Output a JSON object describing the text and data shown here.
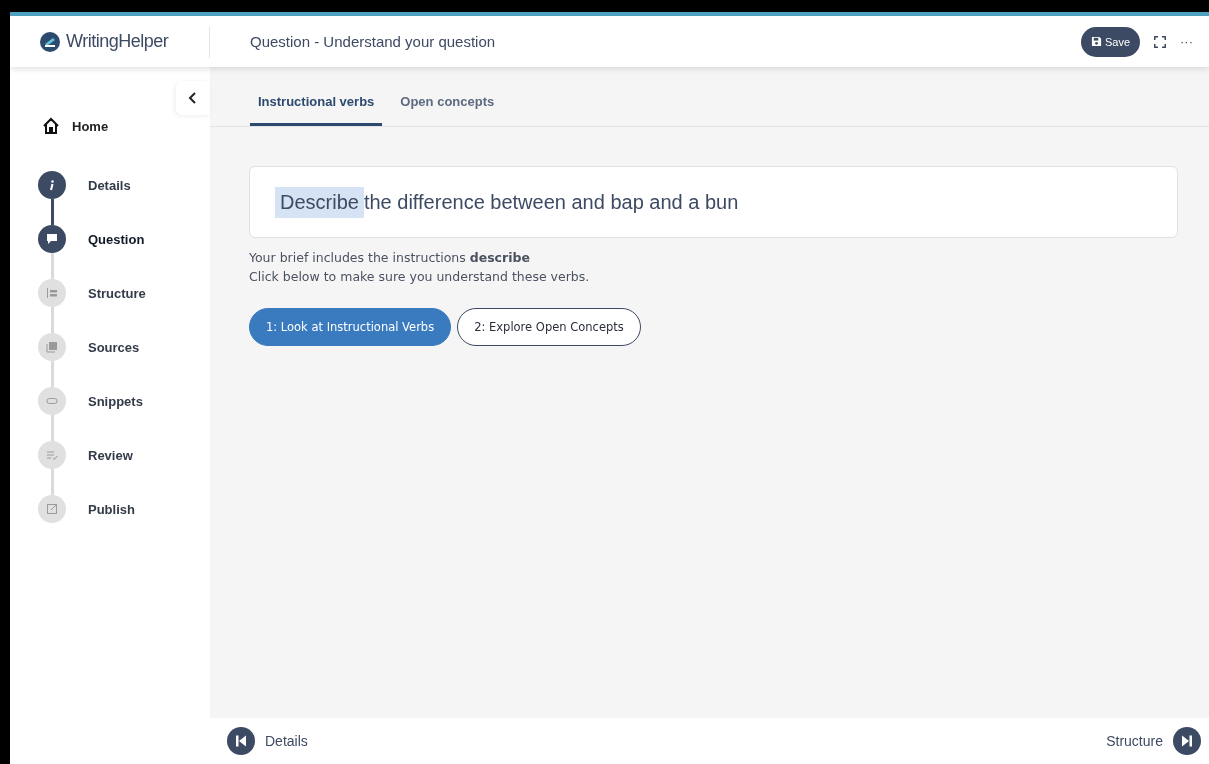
{
  "app": {
    "brand": "WritingHelper",
    "title": "Question - Understand your question",
    "save": "Save",
    "more": "···"
  },
  "sidebar": {
    "home": "Home",
    "steps": [
      {
        "label": "Details",
        "done": true,
        "selected": false
      },
      {
        "label": "Question",
        "done": false,
        "selected": true
      },
      {
        "label": "Structure",
        "done": false,
        "selected": false
      },
      {
        "label": "Sources",
        "done": false,
        "selected": false
      },
      {
        "label": "Snippets",
        "done": false,
        "selected": false
      },
      {
        "label": "Review",
        "done": false,
        "selected": false
      },
      {
        "label": "Publish",
        "done": false,
        "selected": false
      }
    ]
  },
  "tabs": [
    {
      "label": "Instructional verbs",
      "selected": true
    },
    {
      "label": "Open concepts",
      "selected": false
    }
  ],
  "question": {
    "highlighted": "Describe",
    "text": "the difference between and bap and a bun"
  },
  "brief": [
    "Your brief includes the instructions **describe**",
    "Click below to make sure you understand these verbs."
  ],
  "actions": [
    {
      "label": "1: Look at Instructional Verbs",
      "selected": true
    },
    {
      "label": "2: Explore Open Concepts",
      "selected": false
    }
  ],
  "footer": {
    "previous": "Details",
    "next": "Structure"
  }
}
